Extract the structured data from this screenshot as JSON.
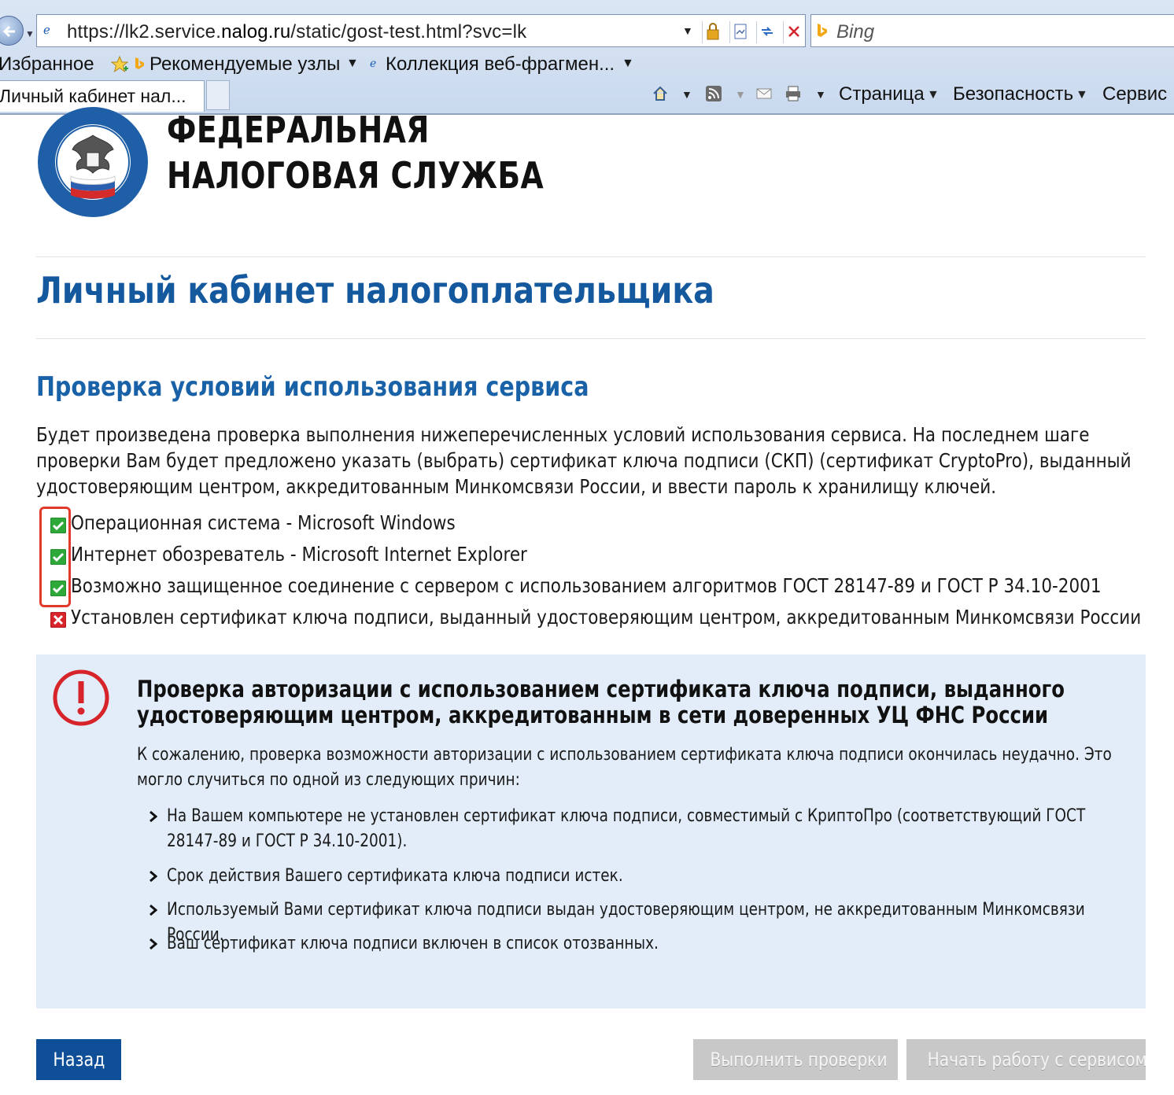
{
  "browser": {
    "url_prefix": "https://lk2.service.",
    "url_domain": "nalog.ru",
    "url_suffix": "/static/gost-test.html?svc=lk",
    "search_placeholder": "Bing",
    "favorites_label": "Избранное",
    "recommended_label": "Рекомендуемые узлы",
    "collection_label": "Коллекция веб-фрагмен...",
    "tab_title": "Личный кабинет нал...",
    "menu_page": "Страница",
    "menu_security": "Безопасность",
    "menu_service": "Сервис"
  },
  "header": {
    "org_line1": "ФЕДЕРАЛЬНАЯ",
    "org_line2": "НАЛОГОВАЯ СЛУЖБА"
  },
  "main": {
    "cabinet_title": "Личный кабинет налогоплательщика",
    "check_title": "Проверка условий использования сервиса",
    "intro": "Будет произведена проверка выполнения нижеперечисленных условий использования сервиса. На последнем шаге проверки Вам будет предложено указать (выбрать) сертификат ключа подписи (СКП) (сертификат CryptoPro), выданный удостоверяющим центром, аккредитованным Минкомсвязи России, и ввести пароль к хранилищу ключей.",
    "conditions": [
      {
        "text": "Операционная система - Microsoft Windows",
        "status": "ok"
      },
      {
        "text": "Интернет обозреватель - Microsoft Internet Explorer",
        "status": "ok"
      },
      {
        "text": "Возможно защищенное соединение с сервером с использованием алгоритмов ГОСТ 28147-89 и ГОСТ Р 34.10-2001",
        "status": "ok"
      },
      {
        "text": "Установлен сертификат ключа подписи, выданный удостоверяющим центром, аккредитованным Минкомсвязи России",
        "status": "fail"
      }
    ]
  },
  "alert": {
    "title": "Проверка авторизации с использованием сертификата ключа подписи, выданного удостоверяющим центром, аккредитованным в сети доверенных УЦ ФНС России",
    "body": "К сожалению, проверка возможности авторизации с использованием сертификата ключа подписи окончилась неудачно. Это могло случиться по одной из следующих причин:",
    "reasons": [
      "На Вашем компьютере не установлен сертификат ключа подписи, совместимый с КриптоПро (соответствующий ГОСТ 28147-89 и ГОСТ Р 34.10-2001).",
      "Срок действия Вашего сертификата ключа подписи истек.",
      "Используемый Вами сертификат ключа подписи выдан удостоверяющим центром, не аккредитованным Минкомсвязи России.",
      "Ваш сертификат ключа подписи включен в список отозванных."
    ]
  },
  "buttons": {
    "back": "Назад",
    "run_checks": "Выполнить проверки",
    "start_work": "Начать работу с сервисом"
  },
  "colors": {
    "brand_blue": "#14589e",
    "alert_bg": "#e2edf9",
    "ok_green": "#2fa83a",
    "fail_red": "#d6242a",
    "highlight_red": "#e1392c",
    "button_blue": "#0e4f98",
    "button_disabled": "#c8c8c8"
  }
}
